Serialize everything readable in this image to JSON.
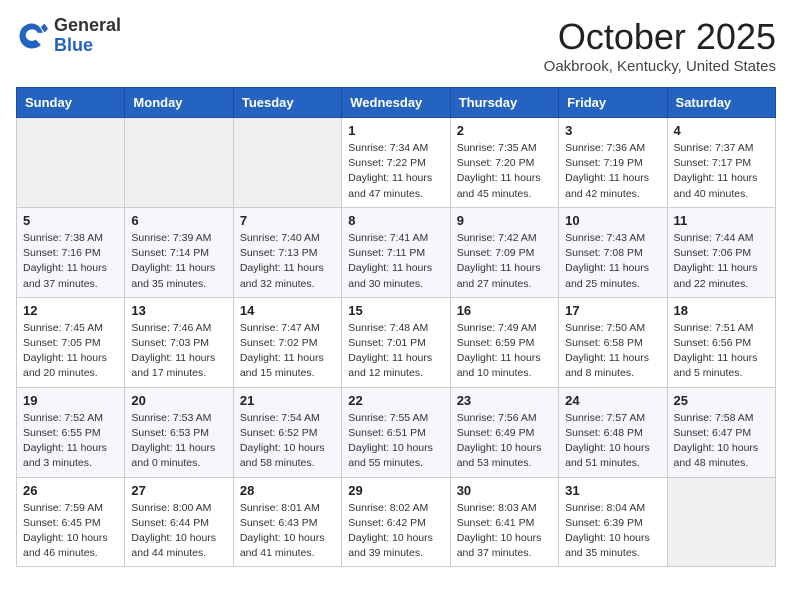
{
  "header": {
    "logo_general": "General",
    "logo_blue": "Blue",
    "month_title": "October 2025",
    "location": "Oakbrook, Kentucky, United States"
  },
  "weekdays": [
    "Sunday",
    "Monday",
    "Tuesday",
    "Wednesday",
    "Thursday",
    "Friday",
    "Saturday"
  ],
  "weeks": [
    [
      {
        "day": "",
        "info": ""
      },
      {
        "day": "",
        "info": ""
      },
      {
        "day": "",
        "info": ""
      },
      {
        "day": "1",
        "info": "Sunrise: 7:34 AM\nSunset: 7:22 PM\nDaylight: 11 hours and 47 minutes."
      },
      {
        "day": "2",
        "info": "Sunrise: 7:35 AM\nSunset: 7:20 PM\nDaylight: 11 hours and 45 minutes."
      },
      {
        "day": "3",
        "info": "Sunrise: 7:36 AM\nSunset: 7:19 PM\nDaylight: 11 hours and 42 minutes."
      },
      {
        "day": "4",
        "info": "Sunrise: 7:37 AM\nSunset: 7:17 PM\nDaylight: 11 hours and 40 minutes."
      }
    ],
    [
      {
        "day": "5",
        "info": "Sunrise: 7:38 AM\nSunset: 7:16 PM\nDaylight: 11 hours and 37 minutes."
      },
      {
        "day": "6",
        "info": "Sunrise: 7:39 AM\nSunset: 7:14 PM\nDaylight: 11 hours and 35 minutes."
      },
      {
        "day": "7",
        "info": "Sunrise: 7:40 AM\nSunset: 7:13 PM\nDaylight: 11 hours and 32 minutes."
      },
      {
        "day": "8",
        "info": "Sunrise: 7:41 AM\nSunset: 7:11 PM\nDaylight: 11 hours and 30 minutes."
      },
      {
        "day": "9",
        "info": "Sunrise: 7:42 AM\nSunset: 7:09 PM\nDaylight: 11 hours and 27 minutes."
      },
      {
        "day": "10",
        "info": "Sunrise: 7:43 AM\nSunset: 7:08 PM\nDaylight: 11 hours and 25 minutes."
      },
      {
        "day": "11",
        "info": "Sunrise: 7:44 AM\nSunset: 7:06 PM\nDaylight: 11 hours and 22 minutes."
      }
    ],
    [
      {
        "day": "12",
        "info": "Sunrise: 7:45 AM\nSunset: 7:05 PM\nDaylight: 11 hours and 20 minutes."
      },
      {
        "day": "13",
        "info": "Sunrise: 7:46 AM\nSunset: 7:03 PM\nDaylight: 11 hours and 17 minutes."
      },
      {
        "day": "14",
        "info": "Sunrise: 7:47 AM\nSunset: 7:02 PM\nDaylight: 11 hours and 15 minutes."
      },
      {
        "day": "15",
        "info": "Sunrise: 7:48 AM\nSunset: 7:01 PM\nDaylight: 11 hours and 12 minutes."
      },
      {
        "day": "16",
        "info": "Sunrise: 7:49 AM\nSunset: 6:59 PM\nDaylight: 11 hours and 10 minutes."
      },
      {
        "day": "17",
        "info": "Sunrise: 7:50 AM\nSunset: 6:58 PM\nDaylight: 11 hours and 8 minutes."
      },
      {
        "day": "18",
        "info": "Sunrise: 7:51 AM\nSunset: 6:56 PM\nDaylight: 11 hours and 5 minutes."
      }
    ],
    [
      {
        "day": "19",
        "info": "Sunrise: 7:52 AM\nSunset: 6:55 PM\nDaylight: 11 hours and 3 minutes."
      },
      {
        "day": "20",
        "info": "Sunrise: 7:53 AM\nSunset: 6:53 PM\nDaylight: 11 hours and 0 minutes."
      },
      {
        "day": "21",
        "info": "Sunrise: 7:54 AM\nSunset: 6:52 PM\nDaylight: 10 hours and 58 minutes."
      },
      {
        "day": "22",
        "info": "Sunrise: 7:55 AM\nSunset: 6:51 PM\nDaylight: 10 hours and 55 minutes."
      },
      {
        "day": "23",
        "info": "Sunrise: 7:56 AM\nSunset: 6:49 PM\nDaylight: 10 hours and 53 minutes."
      },
      {
        "day": "24",
        "info": "Sunrise: 7:57 AM\nSunset: 6:48 PM\nDaylight: 10 hours and 51 minutes."
      },
      {
        "day": "25",
        "info": "Sunrise: 7:58 AM\nSunset: 6:47 PM\nDaylight: 10 hours and 48 minutes."
      }
    ],
    [
      {
        "day": "26",
        "info": "Sunrise: 7:59 AM\nSunset: 6:45 PM\nDaylight: 10 hours and 46 minutes."
      },
      {
        "day": "27",
        "info": "Sunrise: 8:00 AM\nSunset: 6:44 PM\nDaylight: 10 hours and 44 minutes."
      },
      {
        "day": "28",
        "info": "Sunrise: 8:01 AM\nSunset: 6:43 PM\nDaylight: 10 hours and 41 minutes."
      },
      {
        "day": "29",
        "info": "Sunrise: 8:02 AM\nSunset: 6:42 PM\nDaylight: 10 hours and 39 minutes."
      },
      {
        "day": "30",
        "info": "Sunrise: 8:03 AM\nSunset: 6:41 PM\nDaylight: 10 hours and 37 minutes."
      },
      {
        "day": "31",
        "info": "Sunrise: 8:04 AM\nSunset: 6:39 PM\nDaylight: 10 hours and 35 minutes."
      },
      {
        "day": "",
        "info": ""
      }
    ]
  ]
}
